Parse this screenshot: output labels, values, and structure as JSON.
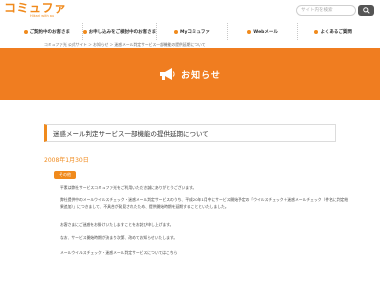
{
  "header": {
    "logo_text": "コミュファ",
    "logo_sub": "Hikari with au",
    "search_placeholder": "サイト内を検索"
  },
  "nav": [
    {
      "label": "ご契約中のお客さま"
    },
    {
      "label": "お申し込みをご検討中のお客さま"
    },
    {
      "label": "Myコミュファ"
    },
    {
      "label": "Webメール"
    },
    {
      "label": "よくあるご質問"
    }
  ],
  "breadcrumb": "コミュファ光 公式サイト ＞ お知らせ ＞ 迷惑メール判定サービス一部機能の提供延期について",
  "banner": {
    "title": "お知らせ"
  },
  "article": {
    "title": "迷惑メール判定サービス一部機能の提供延期について",
    "date": "2008年1月30日",
    "badge": "その他",
    "paragraphs": [
      "平素は弊社サービスコミュファ光をご利用いただき誠にありがとうございます。",
      "弊社提供中のメールウイルスチェック・迷惑メール判定サービスのうち、平成20年1月中にサービス開始予定の「ウイルスチェック＋迷惑メールチェック（件名に判定結果追加）」につきまして、不具合が発見されたため、提供開始時期を延期することといたしました。",
      "お客さまにご迷惑をお掛けいたしますことをお詫び申し上げます。",
      "なお、サービス開始時期が決まり次第、改めてお知らせいたします。",
      "メールウイルスチェック・迷惑メール判定サービスについてはこちら"
    ]
  },
  "colors": {
    "accent": "#f08a1c",
    "banner": "#f07d20"
  }
}
